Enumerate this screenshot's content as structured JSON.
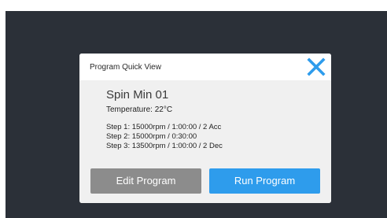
{
  "dialog": {
    "title": "Program Quick View",
    "close_icon": "close-icon",
    "accent_color": "#2e9cec"
  },
  "program": {
    "name": "Spin Min 01",
    "temperature": "Temperature: 22°C",
    "steps": [
      "Step 1: 15000rpm / 1:00:00 / 2 Acc",
      "Step 2: 15000rpm / 0:30:00",
      "Step 3: 13500rpm / 1:00:00 / 2 Dec"
    ]
  },
  "buttons": {
    "edit_label": "Edit Program",
    "run_label": "Run Program",
    "edit_color": "#8c8c8c",
    "run_color": "#2e9cec"
  }
}
